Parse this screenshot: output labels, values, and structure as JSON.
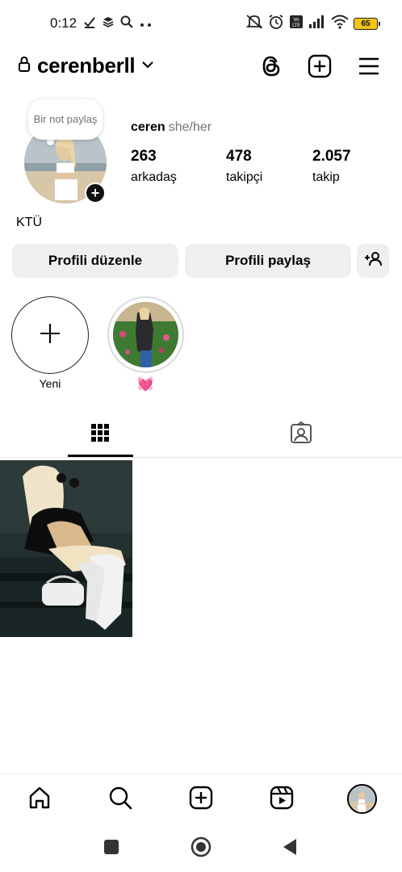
{
  "status_bar": {
    "time": "0:12",
    "battery": "65",
    "icons": [
      "checkmark-download-icon",
      "stack-icon",
      "search-icon",
      "more-dots-icon",
      "mute-icon",
      "alarm-icon",
      "volte-icon",
      "signal-icon",
      "wifi-icon",
      "battery-icon"
    ]
  },
  "header": {
    "username": "cerenberll",
    "icons": [
      "lock-icon",
      "chevron-down-icon",
      "threads-icon",
      "add-post-icon",
      "menu-icon"
    ]
  },
  "profile": {
    "note_text": "Bir not paylaş",
    "name": "ceren",
    "pronouns": "she/her",
    "bio": "KTÜ",
    "stats": [
      {
        "value": "263",
        "label": "arkadaş"
      },
      {
        "value": "478",
        "label": "takipçi"
      },
      {
        "value": "2.057",
        "label": "takip"
      }
    ]
  },
  "buttons": {
    "edit_profile": "Profili düzenle",
    "share_profile": "Profili paylaş"
  },
  "highlights": {
    "new_label": "Yeni",
    "story_label": "💓"
  },
  "tabs": [
    "grid-icon",
    "tagged-icon"
  ],
  "bottom_nav": [
    "home-icon",
    "search-icon",
    "create-icon",
    "reels-icon",
    "profile-avatar"
  ],
  "colors": {
    "button_bg": "#efefef",
    "secondary_text": "#737373",
    "highlight_emoji": "#e23c7c"
  }
}
